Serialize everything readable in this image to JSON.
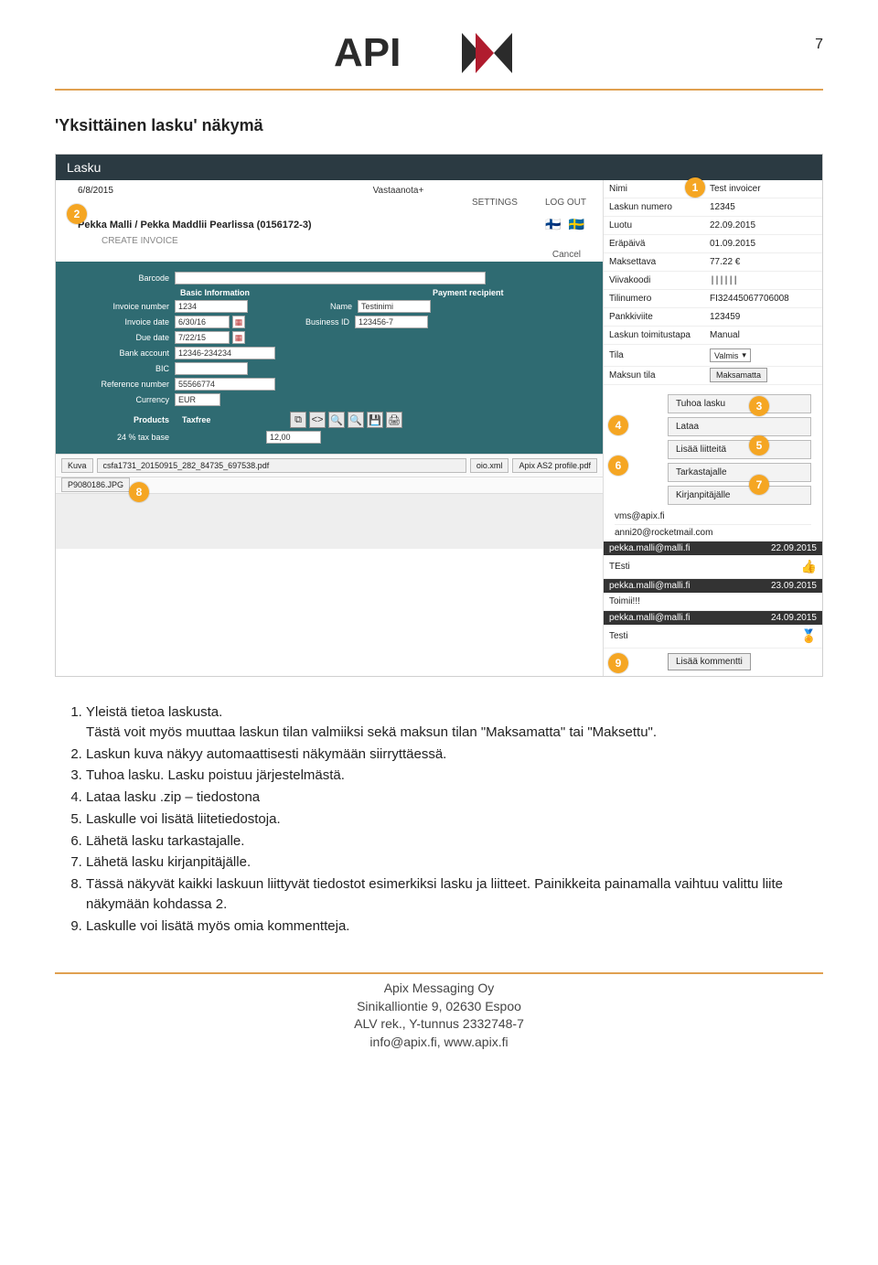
{
  "page_number": "7",
  "doc_title": "'Yksittäinen lasku' näkymä",
  "lasku_bar": "Lasku",
  "top": {
    "date": "6/8/2015",
    "vastaanota": "Vastaanota+",
    "settings": "SETTINGS",
    "logout": "LOG OUT",
    "company": "Pekka Malli / Pekka Maddlii Pearlissa (0156172-3)",
    "create_invoice": "CREATE INVOICE",
    "cancel": "Cancel"
  },
  "form": {
    "barcode_label": "Barcode",
    "basic_info": "Basic Information",
    "payment_recipient": "Payment recipient",
    "invoice_number_label": "Invoice number",
    "invoice_number": "1234",
    "name_label": "Name",
    "name": "Testinimi",
    "invoice_date_label": "Invoice date",
    "invoice_date": "6/30/16",
    "business_id_label": "Business ID",
    "business_id": "123456-7",
    "due_date_label": "Due date",
    "due_date": "7/22/15",
    "bank_account_label": "Bank account",
    "bank_account": "12346-234234",
    "bic_label": "BIC",
    "reference_label": "Reference number",
    "reference": "55566774",
    "currency_label": "Currency",
    "currency": "EUR",
    "products_label": "Products",
    "taxfree_label": "Taxfree",
    "taxbase_label": "24 % tax base",
    "taxbase": "12,00"
  },
  "files": {
    "kuva": "Kuva",
    "f1": "csfa1731_20150915_282_84735_697538.pdf",
    "f2": "oio.xml",
    "f3": "Apix AS2 profile.pdf",
    "row2": "P9080186.JPG"
  },
  "info": {
    "nimi_l": "Nimi",
    "nimi": "Test invoicer",
    "laskunum_l": "Laskun numero",
    "laskunum": "12345",
    "luotu_l": "Luotu",
    "luotu": "22.09.2015",
    "erapaiva_l": "Eräpäivä",
    "erapaiva": "01.09.2015",
    "maksettava_l": "Maksettava",
    "maksettava": "77.22 €",
    "viivakoodi_l": "Viivakoodi",
    "viivakoodi": "||||||",
    "tilinumero_l": "Tilinumero",
    "tilinumero": "FI32445067706008",
    "pankkiviite_l": "Pankkiviite",
    "pankkiviite": "123459",
    "toimitus_l": "Laskun toimitustapa",
    "toimitus": "Manual",
    "tila_l": "Tila",
    "tila": "Valmis",
    "maksuntila_l": "Maksun tila",
    "maksuntila": "Maksamatta"
  },
  "actions": {
    "tuhoa": "Tuhoa lasku",
    "lataa": "Lataa",
    "liitteita": "Lisää liitteitä",
    "tarkastajalle": "Tarkastajalle",
    "kirjanpitajalle": "Kirjanpitäjälle"
  },
  "emails": {
    "e1": "vms@apix.fi",
    "e2": "anni20@rocketmail.com"
  },
  "comments": [
    {
      "from": "pekka.malli@malli.fi",
      "date": "22.09.2015",
      "text": "TEsti",
      "mark": "up"
    },
    {
      "from": "pekka.malli@malli.fi",
      "date": "23.09.2015",
      "text": "Toimii!!!",
      "mark": ""
    },
    {
      "from": "pekka.malli@malli.fi",
      "date": "24.09.2015",
      "text": "Testi",
      "mark": "gold"
    }
  ],
  "add_comment": "Lisää kommentti",
  "explanations": [
    "Yleistä tietoa laskusta.",
    "Tästä voit myös muuttaa laskun tilan valmiiksi sekä maksun tilan \"Maksamatta\" tai \"Maksettu\".",
    "Laskun kuva näkyy automaattisesti näkymään siirryttäessä.",
    "Tuhoa lasku. Lasku poistuu järjestelmästä.",
    "Lataa lasku .zip – tiedostona",
    "Laskulle voi lisätä liitetiedostoja.",
    "Lähetä lasku tarkastajalle.",
    "Lähetä lasku kirjanpitäjälle.",
    "Tässä näkyvät kaikki laskuun liittyvät tiedostot esimerkiksi lasku ja liitteet. Painikkeita painamalla vaihtuu valittu liite näkymään kohdassa 2.",
    "Laskulle voi lisätä myös omia kommentteja."
  ],
  "exp_merge": {
    "1": "Yleistä tietoa laskusta.\nTästä voit myös muuttaa laskun tilan valmiiksi sekä maksun tilan \"Maksamatta\" tai \"Maksettu\"."
  },
  "footer": {
    "l1": "Apix Messaging Oy",
    "l2": "Sinikalliontie 9, 02630 Espoo",
    "l3": "ALV rek., Y-tunnus 2332748-7",
    "l4": "info@apix.fi, www.apix.fi"
  }
}
